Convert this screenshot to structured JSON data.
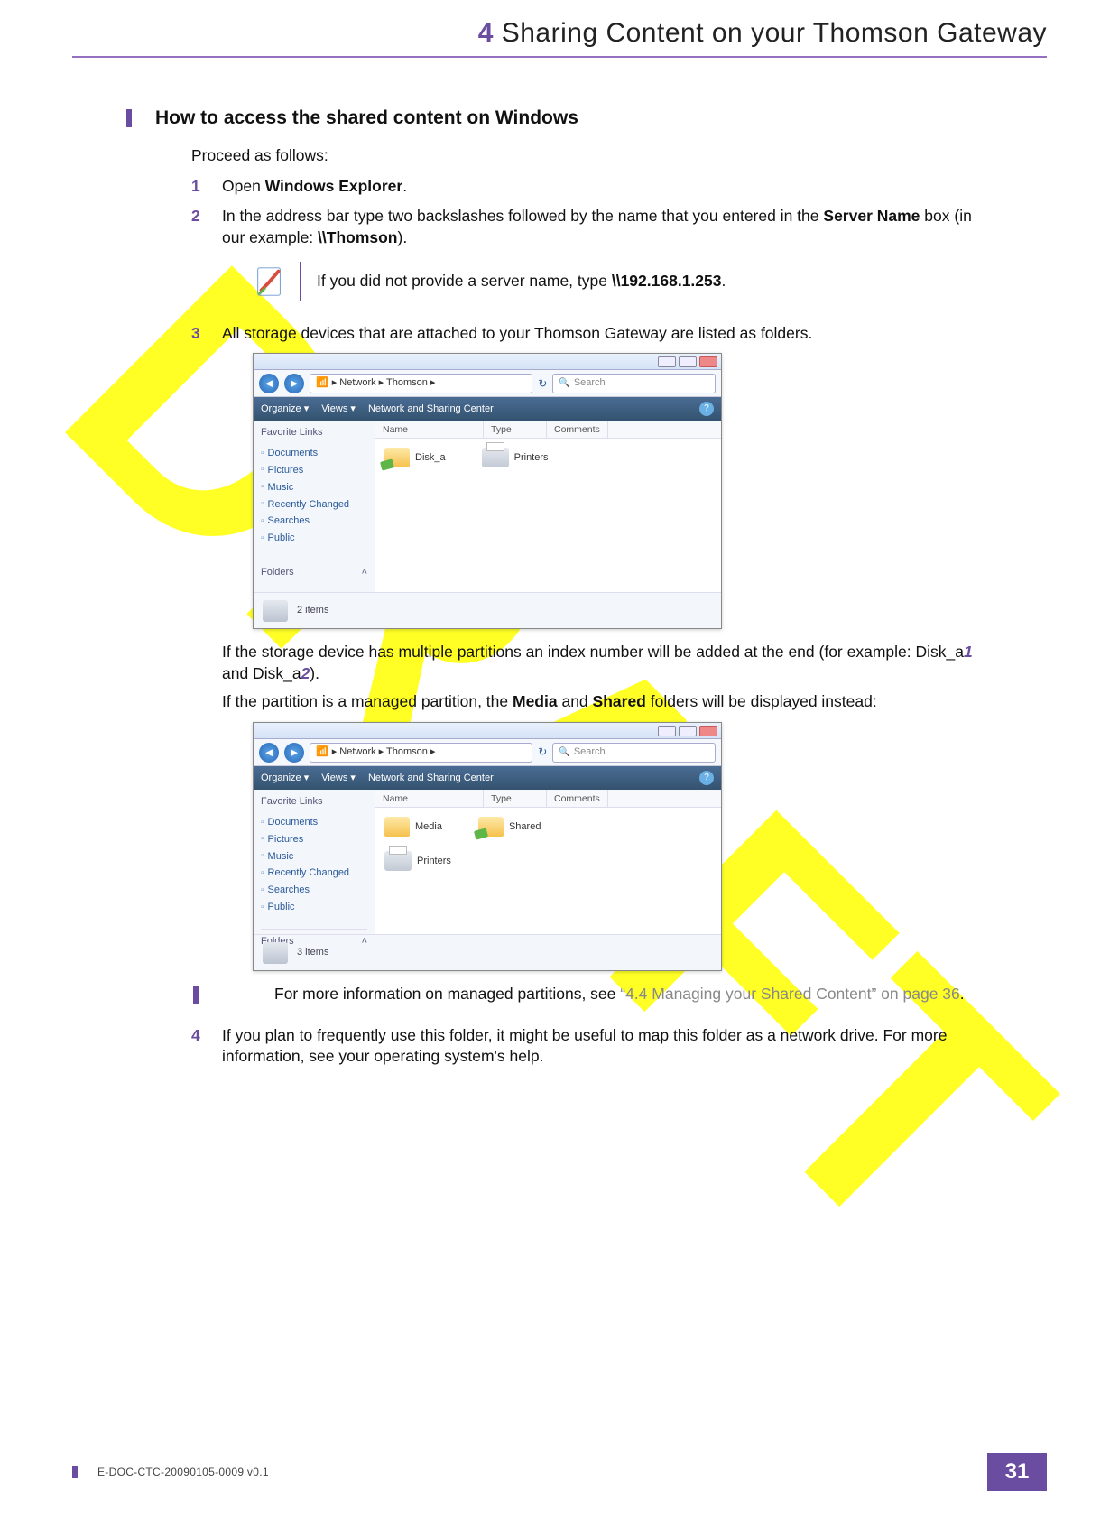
{
  "watermark": "DRAFT",
  "header": {
    "chapter_num": "4",
    "chapter_title": "Sharing Content on your Thomson Gateway"
  },
  "section": {
    "heading": "How to access the shared content on Windows",
    "intro": "Proceed as follows:",
    "steps": {
      "s1": {
        "num": "1",
        "text_a": "Open ",
        "bold_a": "Windows Explorer",
        "text_b": "."
      },
      "s2": {
        "num": "2",
        "line1_a": "In the address bar type two backslashes followed by the name that you entered in the ",
        "line1_bold": "Server Name",
        "line1_b": " box (in our example: ",
        "line1_bold2": "\\\\Thomson",
        "line1_c": ").",
        "note_a": "If you did not provide a server name, type ",
        "note_bold": "\\\\192.168.1.253",
        "note_b": "."
      },
      "s3": {
        "num": "3",
        "line1": "All storage devices that are attached to your Thomson Gateway are listed as folders.",
        "line2_a": "If the storage device has multiple partitions an index number will be added at the end (for example: Disk_a",
        "line2_it1": "1",
        "line2_b": " and Disk_a",
        "line2_it2": "2",
        "line2_c": ").",
        "line3_a": "If the partition is a managed partition, the ",
        "line3_bold1": "Media",
        "line3_b": " and ",
        "line3_bold2": "Shared",
        "line3_c": " folders will be displayed instead:",
        "aside_a": "For more information on managed partitions, see ",
        "aside_ref": "“4.4 Managing your Shared Content” on page 36",
        "aside_b": "."
      },
      "s4": {
        "num": "4",
        "text": "If you plan to frequently use this folder, it might be useful to map this folder as a network drive. For more information, see your operating system's help."
      }
    }
  },
  "explorer1": {
    "crumbs_a": "▸ Network ▸ Thomson ▸",
    "search_ph": "Search",
    "tb_organize": "Organize ▾",
    "tb_views": "Views ▾",
    "tb_nsc": "Network and Sharing Center",
    "side_hdr": "Favorite Links",
    "links": [
      "Documents",
      "Pictures",
      "Music",
      "Recently Changed",
      "Searches",
      "Public"
    ],
    "folders": "Folders",
    "cols": [
      "Name",
      "Type",
      "Comments"
    ],
    "items": [
      "Disk_a",
      "Printers"
    ],
    "status": "2 items"
  },
  "explorer2": {
    "crumbs_a": "▸ Network ▸ Thomson ▸",
    "search_ph": "Search",
    "tb_organize": "Organize ▾",
    "tb_views": "Views ▾",
    "tb_nsc": "Network and Sharing Center",
    "side_hdr": "Favorite Links",
    "links": [
      "Documents",
      "Pictures",
      "Music",
      "Recently Changed",
      "Searches",
      "Public"
    ],
    "folders": "Folders",
    "cols": [
      "Name",
      "Type",
      "Comments"
    ],
    "items": [
      "Media",
      "Shared",
      "Printers"
    ],
    "status": "3 items"
  },
  "footer": {
    "doc_id": "E-DOC-CTC-20090105-0009 v0.1",
    "page_num": "31"
  }
}
